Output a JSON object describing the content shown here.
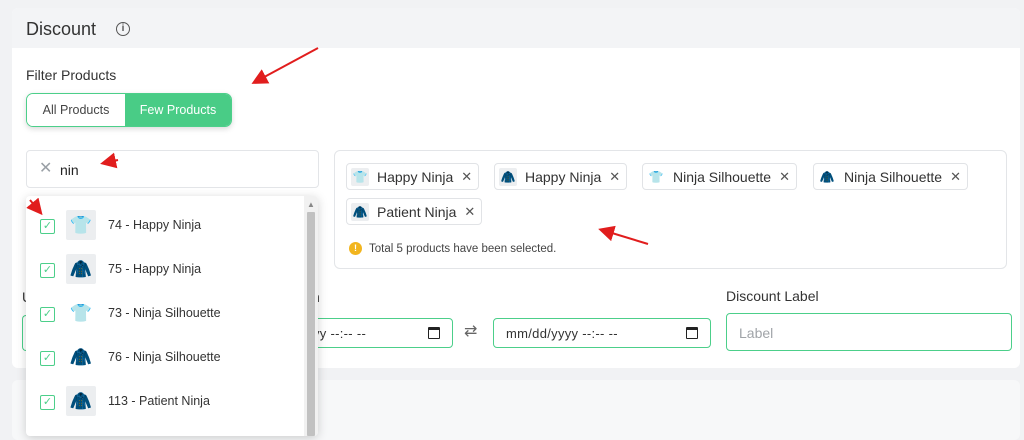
{
  "section": {
    "title": "Discount",
    "info_icon": "info-icon"
  },
  "filter": {
    "label": "Filter Products",
    "options": [
      {
        "label": "All Products",
        "active": false
      },
      {
        "label": "Few Products",
        "active": true
      }
    ]
  },
  "search": {
    "value": "nin",
    "clear_icon": "close-icon"
  },
  "dropdown": {
    "items": [
      {
        "label": "74 - Happy Ninja",
        "checked": true,
        "thumb": "tshirt-gray-icon"
      },
      {
        "label": "75 - Happy Ninja",
        "checked": true,
        "thumb": "hoodie-gray-icon"
      },
      {
        "label": "73 - Ninja Silhouette",
        "checked": true,
        "thumb": "tshirt-black-icon"
      },
      {
        "label": "76 - Ninja Silhouette",
        "checked": true,
        "thumb": "hoodie-black-icon"
      },
      {
        "label": "113 - Patient Ninja",
        "checked": true,
        "thumb": "hoodie-gray-icon"
      }
    ]
  },
  "selected": {
    "chips": [
      {
        "label": "Happy Ninja",
        "thumb": "tshirt-gray-icon"
      },
      {
        "label": "Happy Ninja",
        "thumb": "hoodie-gray-icon"
      },
      {
        "label": "Ninja Silhouette",
        "thumb": "tshirt-black-icon"
      },
      {
        "label": "Ninja Silhouette",
        "thumb": "hoodie-black-icon"
      },
      {
        "label": "Patient Ninja",
        "thumb": "hoodie-gray-icon"
      }
    ],
    "notice": "Total 5 products have been selected."
  },
  "fields": {
    "partial_label_left": "U",
    "partial_label_mid": "n",
    "date_start_fragment": "yy --:-- --",
    "date_end": "mm/dd/yyyy --:-- --",
    "discount_label": "Discount Label",
    "discount_placeholder": "Label"
  },
  "colors": {
    "accent": "#49cc86",
    "border_accent": "#4ccf8a",
    "notice": "#f2b51e"
  }
}
